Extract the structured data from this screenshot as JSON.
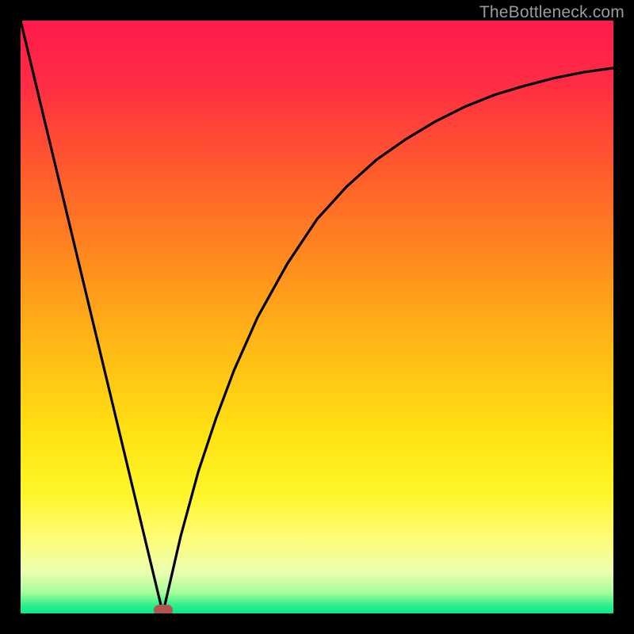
{
  "watermark": "TheBottleneck.com",
  "chart_data": {
    "type": "line",
    "title": "",
    "xlabel": "",
    "ylabel": "",
    "xlim": [
      0,
      1
    ],
    "ylim": [
      0,
      1
    ],
    "series": [
      {
        "name": "left-slope",
        "x": [
          0.0,
          0.24
        ],
        "y": [
          1.0,
          0.0
        ]
      },
      {
        "name": "right-curve",
        "x": [
          0.24,
          0.27,
          0.3,
          0.33,
          0.36,
          0.4,
          0.45,
          0.5,
          0.55,
          0.6,
          0.65,
          0.7,
          0.75,
          0.8,
          0.85,
          0.9,
          0.95,
          1.0
        ],
        "y": [
          0.0,
          0.13,
          0.24,
          0.33,
          0.41,
          0.5,
          0.59,
          0.665,
          0.72,
          0.765,
          0.8,
          0.83,
          0.855,
          0.875,
          0.89,
          0.903,
          0.913,
          0.92
        ]
      }
    ],
    "annotations": [
      {
        "name": "minimum-dot",
        "x": 0.24,
        "y": 0.0
      }
    ],
    "background_gradient": {
      "stops": [
        {
          "offset": 0.0,
          "color": "#ff1a4d"
        },
        {
          "offset": 0.1,
          "color": "#ff2b45"
        },
        {
          "offset": 0.25,
          "color": "#ff5a2c"
        },
        {
          "offset": 0.4,
          "color": "#ff8a1e"
        },
        {
          "offset": 0.55,
          "color": "#ffb915"
        },
        {
          "offset": 0.7,
          "color": "#ffe312"
        },
        {
          "offset": 0.8,
          "color": "#fff62a"
        },
        {
          "offset": 0.875,
          "color": "#fffc7a"
        },
        {
          "offset": 0.93,
          "color": "#eaffb0"
        },
        {
          "offset": 0.965,
          "color": "#a6fd9a"
        },
        {
          "offset": 0.985,
          "color": "#35f08b"
        },
        {
          "offset": 1.0,
          "color": "#08e88a"
        }
      ]
    }
  }
}
